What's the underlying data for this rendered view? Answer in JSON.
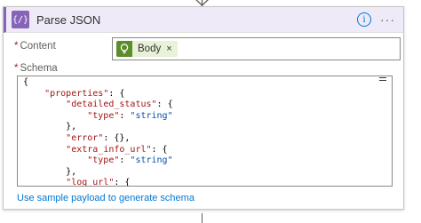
{
  "action": {
    "title": "Parse JSON",
    "icon": "braces-icon",
    "icon_glyph": "{/}",
    "info_glyph": "i",
    "more_glyph": "···",
    "accent_color": "#8764b8"
  },
  "content_field": {
    "label": "Content",
    "required_mark": "*",
    "token": {
      "label": "Body",
      "close": "×",
      "color": "#5d8c2b"
    }
  },
  "schema_field": {
    "label": "Schema",
    "required_mark": "*",
    "lines": [
      {
        "t": "{"
      },
      {
        "t": "    \"properties\": {"
      },
      {
        "t": "        \"detailed_status\": {"
      },
      {
        "t": "            \"type\": \"string\""
      },
      {
        "t": "        },"
      },
      {
        "t": "        \"error\": {},"
      },
      {
        "t": "        \"extra_info_url\": {"
      },
      {
        "t": "            \"type\": \"string\""
      },
      {
        "t": "        },"
      },
      {
        "t": "        \"log_url\": {"
      }
    ]
  },
  "sample_link": "Use sample payload to generate schema"
}
